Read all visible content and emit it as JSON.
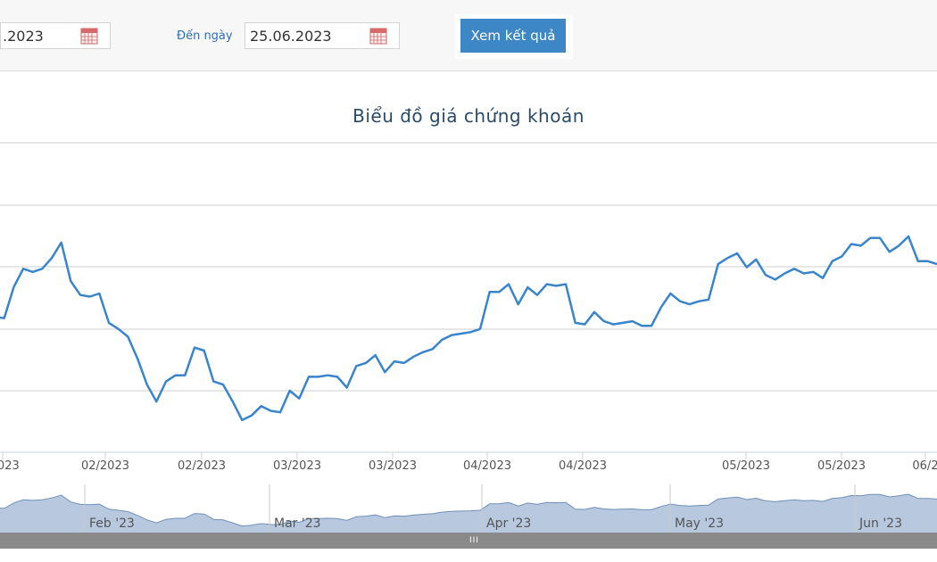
{
  "filters": {
    "from_value": ".2023",
    "to_label": "Đến ngày",
    "to_value": "25.06.2023",
    "submit_label": "Xem kết quả"
  },
  "colors": {
    "line": "#3a84cc",
    "navigator_fill": "#b7c8df",
    "navigator_line": "#6f90b9",
    "grid": "#cfcfcf"
  },
  "chart_data": {
    "type": "line",
    "title": "Biểu đồ giá chứng khoán",
    "x_tick_labels": [
      "/2023",
      "02/2023",
      "02/2023",
      "03/2023",
      "03/2023",
      "04/2023",
      "04/2023",
      "05/2023",
      "05/2023",
      "06/2"
    ],
    "y_tick_labels": [],
    "grid": true,
    "series": [
      {
        "values": [
          2.48,
          2.47,
          2.67,
          2.79,
          2.77,
          2.79,
          2.86,
          2.96,
          2.71,
          2.62,
          2.61,
          2.63,
          2.44,
          2.4,
          2.35,
          2.21,
          2.04,
          1.93,
          2.06,
          2.1,
          2.1,
          2.28,
          2.26,
          2.06,
          2.04,
          1.93,
          1.81,
          1.84,
          1.9,
          1.87,
          1.86,
          2.0,
          1.95,
          2.09,
          2.09,
          2.1,
          2.09,
          2.02,
          2.16,
          2.18,
          2.23,
          2.12,
          2.19,
          2.18,
          2.22,
          2.25,
          2.27,
          2.33,
          2.36,
          2.37,
          2.38,
          2.4,
          2.64,
          2.64,
          2.69,
          2.56,
          2.67,
          2.62,
          2.69,
          2.68,
          2.69,
          2.44,
          2.43,
          2.51,
          2.45,
          2.43,
          2.44,
          2.45,
          2.42,
          2.42,
          2.54,
          2.63,
          2.58,
          2.56,
          2.58,
          2.59,
          2.82,
          2.86,
          2.89,
          2.8,
          2.85,
          2.75,
          2.72,
          2.76,
          2.79,
          2.76,
          2.77,
          2.73,
          2.84,
          2.87,
          2.95,
          2.94,
          2.99,
          2.99,
          2.9,
          2.94,
          3.0,
          2.84,
          2.84,
          2.82
        ]
      }
    ]
  },
  "navigator": {
    "month_labels": [
      "Feb '23",
      "Mar '23",
      "Apr '23",
      "May '23",
      "Jun '23"
    ],
    "grip": "III"
  }
}
